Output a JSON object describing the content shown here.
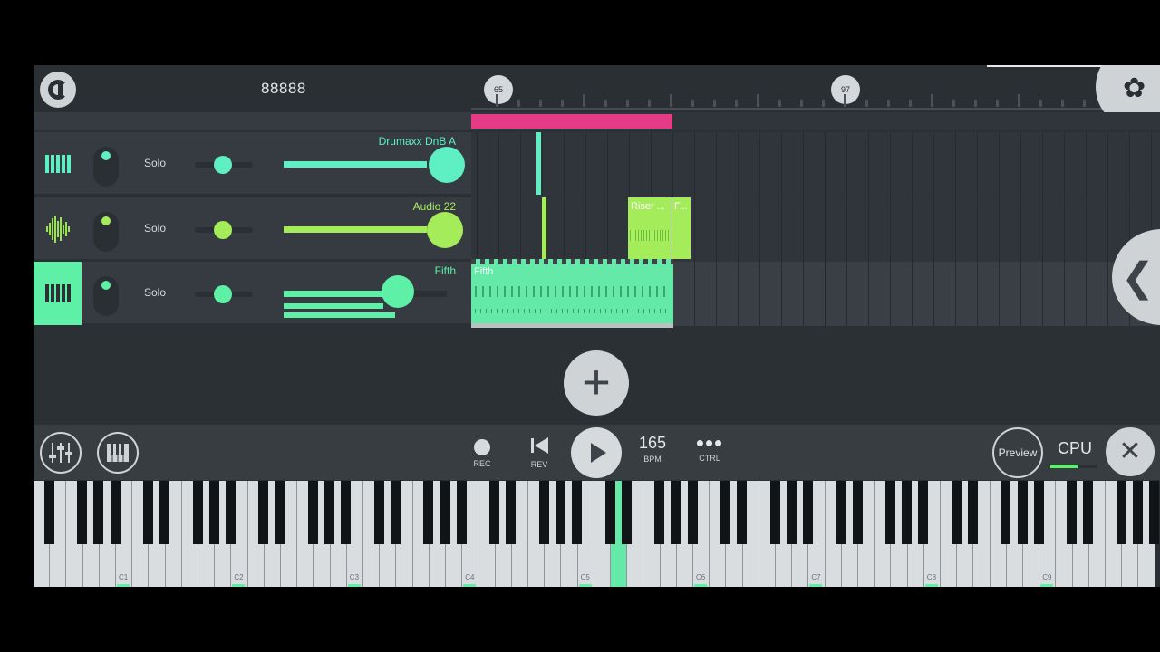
{
  "topbar": {
    "counter": "88888",
    "markers": [
      "65",
      "97"
    ]
  },
  "tracks": [
    {
      "name": "Drumaxx DnB A",
      "solo": "Solo",
      "color": "#5ef0c2",
      "icon": "piano-keys-icon"
    },
    {
      "name": "Audio 22",
      "solo": "Solo",
      "color": "#a5ec5a",
      "icon": "waveform-icon"
    },
    {
      "name": "Fifth",
      "solo": "Solo",
      "color": "#5ef0a6",
      "icon": "piano-keys-icon"
    }
  ],
  "clips": {
    "riser": "Riser ...",
    "f": "F...",
    "fifth": "Fifth"
  },
  "add": "+",
  "transport": {
    "rec": "REC",
    "rev": "REV",
    "bpm_value": "165",
    "bpm": "BPM",
    "ctrl_dots": "•••",
    "ctrl": "CTRL",
    "preview": "Preview",
    "cpu": "CPU",
    "cpu_level": 0.6,
    "close": "✕"
  },
  "keyboard": {
    "octaves": [
      "C1",
      "C2",
      "C3",
      "C4",
      "C5",
      "C6",
      "C7",
      "C8",
      "C9"
    ]
  },
  "colors": {
    "accent_green": "#5ef0a6",
    "pink": "#e53a86",
    "lime": "#a5ec5a"
  }
}
